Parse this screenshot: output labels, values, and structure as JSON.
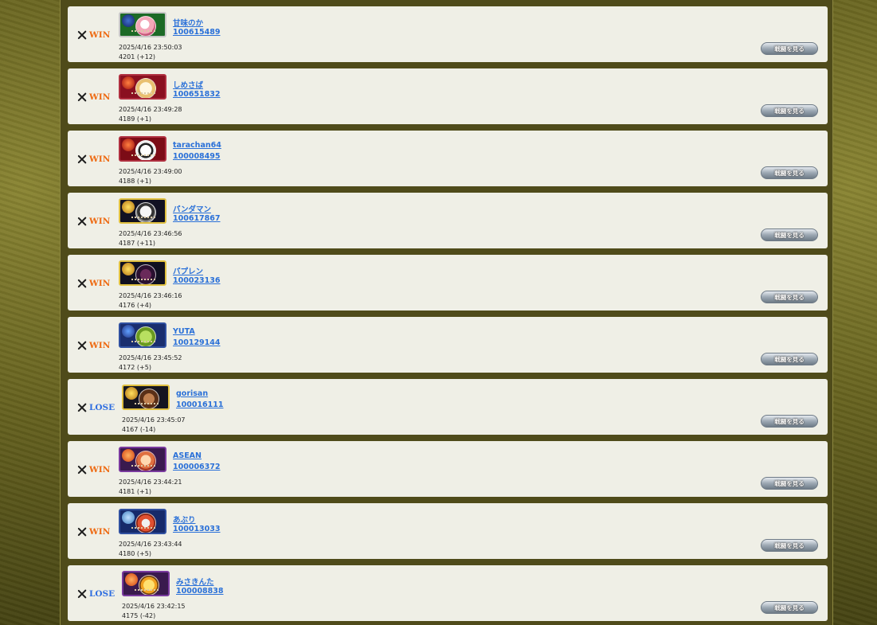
{
  "colors": {
    "win": "#ee6a12",
    "lose": "#2f6ee0",
    "link": "#2a70d8"
  },
  "battles": [
    {
      "result": "WIN",
      "name": "甘味のか",
      "id": "100615489",
      "datetime": "2025/4/16 23:50:03",
      "rating": "4201 (+12)",
      "button": "戦闘を見る",
      "banner_color": "#1c6a26",
      "emblem": "sword-emblem-icon",
      "border": "#c7c7c7"
    },
    {
      "result": "WIN",
      "name": "しめさば",
      "id": "100651832",
      "datetime": "2025/4/16 23:49:28",
      "rating": "4189 (+1)",
      "button": "戦闘を見る",
      "banner_color": "#8a1020",
      "emblem": "flame-emblem-icon",
      "border": "#b03040"
    },
    {
      "result": "WIN",
      "name": "tarachan64",
      "id": "100008495",
      "datetime": "2025/4/16 23:49:00",
      "rating": "4188 (+1)",
      "button": "戦闘を見る",
      "banner_color": "#7c0c16",
      "emblem": "flame-emblem-icon",
      "border": "#b03040"
    },
    {
      "result": "WIN",
      "name": "パンダマン",
      "id": "100617867",
      "datetime": "2025/4/16 23:46:56",
      "rating": "4187 (+11)",
      "button": "戦闘を見る",
      "banner_color": "#111122",
      "emblem": "crown-emblem-icon",
      "border": "#e0c040"
    },
    {
      "result": "WIN",
      "name": "パプレン",
      "id": "100023136",
      "datetime": "2025/4/16 23:46:16",
      "rating": "4176 (+4)",
      "button": "戦闘を見る",
      "banner_color": "#101020",
      "emblem": "crown-emblem-icon",
      "border": "#e0c040"
    },
    {
      "result": "WIN",
      "name": "YUTA",
      "id": "100129144",
      "datetime": "2025/4/16 23:45:52",
      "rating": "4172 (+5)",
      "button": "戦闘を見る",
      "banner_color": "#1a2e6e",
      "emblem": "serpent-emblem-icon",
      "border": "#3050a0"
    },
    {
      "result": "LOSE",
      "name": "gorisan",
      "id": "100016111",
      "datetime": "2025/4/16 23:45:07",
      "rating": "4167 (-14)",
      "button": "戦闘を見る",
      "banner_color": "#151520",
      "emblem": "crown-emblem-icon",
      "border": "#e0c040"
    },
    {
      "result": "WIN",
      "name": "ASEAN",
      "id": "100006372",
      "datetime": "2025/4/16 23:44:21",
      "rating": "4181 (+1)",
      "button": "戦闘を見る",
      "banner_color": "#3a1a4e",
      "emblem": "wing-emblem-icon",
      "border": "#7a3a9e"
    },
    {
      "result": "WIN",
      "name": "あぶり",
      "id": "100013033",
      "datetime": "2025/4/16 23:43:44",
      "rating": "4180 (+5)",
      "button": "戦闘を見る",
      "banner_color": "#162a6a",
      "emblem": "gem-emblem-icon",
      "border": "#3050a0"
    },
    {
      "result": "LOSE",
      "name": "みさきんた",
      "id": "100008838",
      "datetime": "2025/4/16 23:42:15",
      "rating": "4175 (-42)",
      "button": "戦闘を見る",
      "banner_color": "#3a1a4e",
      "emblem": "wing-emblem-icon",
      "border": "#7a3a9e"
    }
  ]
}
